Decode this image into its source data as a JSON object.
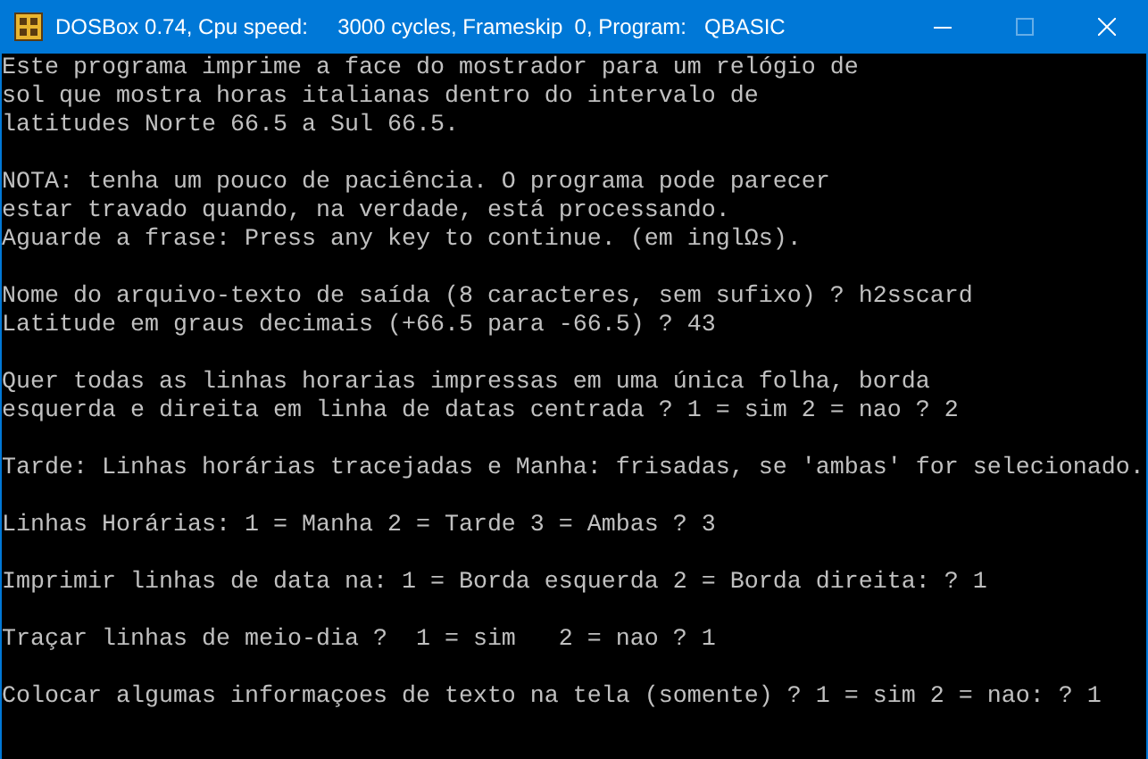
{
  "window": {
    "title": "DOSBox 0.74, Cpu speed:     3000 cycles, Frameskip  0, Program:   QBASIC",
    "maximize_disabled": true
  },
  "console": {
    "groups": [
      [
        "Este programa imprime a face do mostrador para um relógio de",
        "sol que mostra horas italianas dentro do intervalo de",
        "latitudes Norte 66.5 a Sul 66.5."
      ],
      [
        "NOTA: tenha um pouco de paciência. O programa pode parecer",
        "estar travado quando, na verdade, está processando.",
        "Aguarde a frase: Press any key to continue. (em inglΩs)."
      ],
      [
        "Nome do arquivo-texto de saída (8 caracteres, sem sufixo) ? h2sscard",
        "Latitude em graus decimais (+66.5 para -66.5) ? 43"
      ],
      [
        "Quer todas as linhas horarias impressas em uma única folha, borda",
        "esquerda e direita em linha de datas centrada ? 1 = sim 2 = nao ? 2"
      ],
      [
        "Tarde: Linhas horárias tracejadas e Manha: frisadas, se 'ambas' for selecionado."
      ],
      [
        "Linhas Horárias: 1 = Manha 2 = Tarde 3 = Ambas ? 3"
      ],
      [
        "Imprimir linhas de data na: 1 = Borda esquerda 2 = Borda direita: ? 1"
      ],
      [
        "Traçar linhas de meio-dia ?  1 = sim   2 = nao ? 1"
      ],
      [
        "Colocar algumas informaçoes de texto na tela (somente) ? 1 = sim 2 = nao: ? 1"
      ]
    ]
  }
}
